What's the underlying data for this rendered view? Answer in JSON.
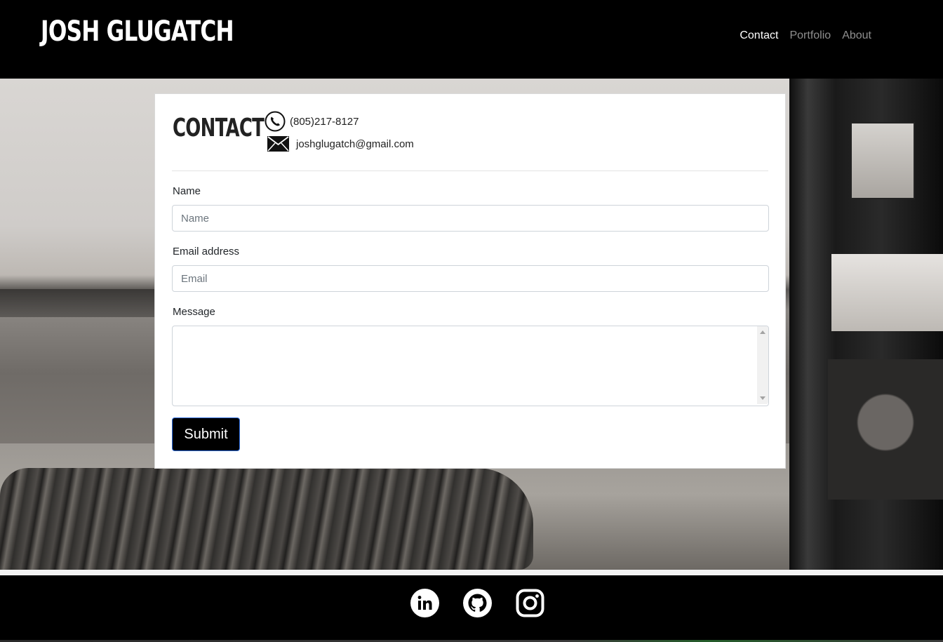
{
  "header": {
    "brand": "JOSH GLUGATCH",
    "nav": [
      {
        "label": "Contact",
        "active": true
      },
      {
        "label": "Portfolio",
        "active": false
      },
      {
        "label": "About",
        "active": false
      }
    ]
  },
  "contact": {
    "title": "CONTACT",
    "phone": "(805)217-8127",
    "email": "joshglugatch@gmail.com",
    "phone_icon": "phone-icon",
    "email_icon": "envelope-icon"
  },
  "form": {
    "name_label": "Name",
    "name_placeholder": "Name",
    "name_value": "",
    "email_label": "Email address",
    "email_placeholder": "Email",
    "email_value": "",
    "message_label": "Message",
    "message_value": "",
    "submit_label": "Submit"
  },
  "footer": {
    "social": [
      {
        "name": "linkedin-icon"
      },
      {
        "name": "github-icon"
      },
      {
        "name": "instagram-icon"
      }
    ]
  },
  "colors": {
    "header_bg": "#000000",
    "card_bg": "#ffffff",
    "submit_bg": "#000000",
    "submit_border": "#2d6cdf"
  }
}
